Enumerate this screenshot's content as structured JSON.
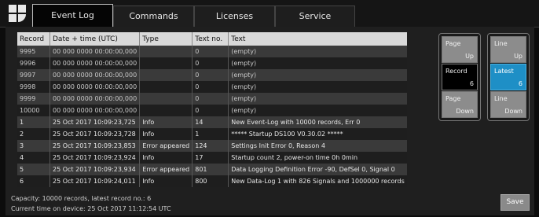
{
  "tabs": [
    {
      "label": "Event Log"
    },
    {
      "label": "Commands"
    },
    {
      "label": "Licenses"
    },
    {
      "label": "Service"
    }
  ],
  "table": {
    "headers": [
      "Record",
      "Date + time (UTC)",
      "Type",
      "Text no.",
      "Text"
    ],
    "rows": [
      [
        "9995",
        "00 000 0000 00:00:00,000",
        "",
        "0",
        "(empty)"
      ],
      [
        "9996",
        "00 000 0000 00:00:00,000",
        "",
        "0",
        "(empty)"
      ],
      [
        "9997",
        "00 000 0000 00:00:00,000",
        "",
        "0",
        "(empty)"
      ],
      [
        "9998",
        "00 000 0000 00:00:00,000",
        "",
        "0",
        "(empty)"
      ],
      [
        "9999",
        "00 000 0000 00:00:00,000",
        "",
        "0",
        "(empty)"
      ],
      [
        "10000",
        "00 000 0000 00:00:00,000",
        "",
        "0",
        "(empty)"
      ],
      [
        "1",
        "25 Oct 2017 10:09:23,725",
        "Info",
        "14",
        "New Event-Log with 10000 records, Err 0"
      ],
      [
        "2",
        "25 Oct 2017 10:09:23,728",
        "Info",
        "1",
        "***** Startup DS100 V0.30.02 *****"
      ],
      [
        "3",
        "25 Oct 2017 10:09:23,853",
        "Error appeared",
        "124",
        "Settings Init Error 0, Reason 4"
      ],
      [
        "4",
        "25 Oct 2017 10:09:23,924",
        "Info",
        "17",
        "Startup count 2, power-on time 0h 0min"
      ],
      [
        "5",
        "25 Oct 2017 10:09:23,934",
        "Error appeared",
        "801",
        "Data Logging Definition Error -90, DefSel 0, Signal 0"
      ],
      [
        "6",
        "25 Oct 2017 10:09:24,011",
        "Info",
        "800",
        "New Data-Log 1 with 826 Signals and 1000000 records"
      ]
    ]
  },
  "footer": {
    "capacity": "Capacity: 10000 records, latest record no.: 6",
    "current_time": "Current time on device: 25 Oct 2017 11:12:54 UTC"
  },
  "nav": {
    "page_up": {
      "top": "Page",
      "bottom": "Up"
    },
    "record": {
      "top": "Record",
      "bottom": "6"
    },
    "page_down": {
      "top": "Page",
      "bottom": "Down"
    },
    "line_up": {
      "top": "Line",
      "bottom": "Up"
    },
    "latest": {
      "top": "Latest",
      "bottom": "6"
    },
    "line_down": {
      "top": "Line",
      "bottom": "Down"
    }
  },
  "save_label": "Save",
  "colors": {
    "accent": "#1e8fc6",
    "header_bg": "#d9d9d9",
    "row_odd": "#3a3a3a",
    "row_even": "#1e1e1e"
  }
}
